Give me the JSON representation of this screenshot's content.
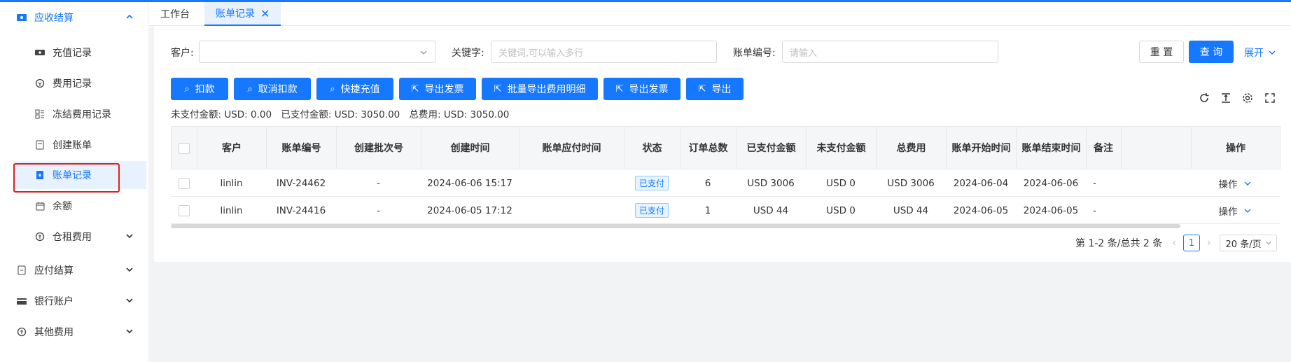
{
  "sidebar": {
    "groups": [
      {
        "label": "应收结算",
        "icon": "ticket-icon"
      },
      {
        "label": "应付结算",
        "icon": "receipt-icon"
      },
      {
        "label": "银行账户",
        "icon": "card-icon"
      },
      {
        "label": "其他费用",
        "icon": "coins-icon"
      }
    ],
    "items": [
      {
        "label": "充值记录",
        "icon": "ticket-icon"
      },
      {
        "label": "费用记录",
        "icon": "money-icon"
      },
      {
        "label": "冻结费用记录",
        "icon": "grid-icon"
      },
      {
        "label": "创建账单",
        "icon": "document-icon"
      },
      {
        "label": "账单记录",
        "icon": "bill-icon"
      },
      {
        "label": "余额",
        "icon": "calendar-icon"
      },
      {
        "label": "仓租费用",
        "icon": "coins-icon"
      }
    ]
  },
  "tabs": [
    {
      "label": "工作台"
    },
    {
      "label": "账单记录",
      "close": "✕"
    }
  ],
  "filters": {
    "customer_label": "客户:",
    "keyword_label": "关键字:",
    "keyword_placeholder": "关键词,可以输入多行",
    "bill_no_label": "账单编号:",
    "bill_no_placeholder": "请输入",
    "reset": "重 置",
    "search": "查 询",
    "expand": "展开"
  },
  "actions": [
    "扣款",
    "取消扣款",
    "快捷充值",
    "导出发票",
    "批量导出费用明细",
    "导出发票",
    "导出"
  ],
  "summary": {
    "unpaid": "未支付金额: USD: 0.00",
    "paid": "已支付金额: USD: 3050.00",
    "total": "总费用: USD: 3050.00"
  },
  "table": {
    "headers": [
      "客户",
      "账单编号",
      "创建批次号",
      "创建时间",
      "账单应付时间",
      "状态",
      "订单总数",
      "已支付金额",
      "未支付金额",
      "总费用",
      "账单开始时间",
      "账单结束时间",
      "备注",
      "",
      "操作"
    ],
    "rows": [
      {
        "customer": "linlin",
        "bill_no": "INV-24462",
        "batch": "-",
        "created": "2024-06-06 15:17",
        "due": "",
        "status": "已支付",
        "orders": "6",
        "paid": "USD 3006",
        "unpaid": "USD 0",
        "total": "USD 3006",
        "start": "2024-06-04",
        "end": "2024-06-06",
        "remark": "-",
        "op": "操作"
      },
      {
        "customer": "linlin",
        "bill_no": "INV-24416",
        "batch": "-",
        "created": "2024-06-05 17:12",
        "due": "",
        "status": "已支付",
        "orders": "1",
        "paid": "USD 44",
        "unpaid": "USD 0",
        "total": "USD 44",
        "start": "2024-06-05",
        "end": "2024-06-05",
        "remark": "-",
        "op": "操作"
      }
    ]
  },
  "pagination": {
    "summary": "第 1-2 条/总共 2 条",
    "current": "1",
    "page_size": "20 条/页"
  },
  "colors": {
    "accent": "#1677ff",
    "selected_bg": "#e8f2ff",
    "highlight": "#e02020"
  }
}
